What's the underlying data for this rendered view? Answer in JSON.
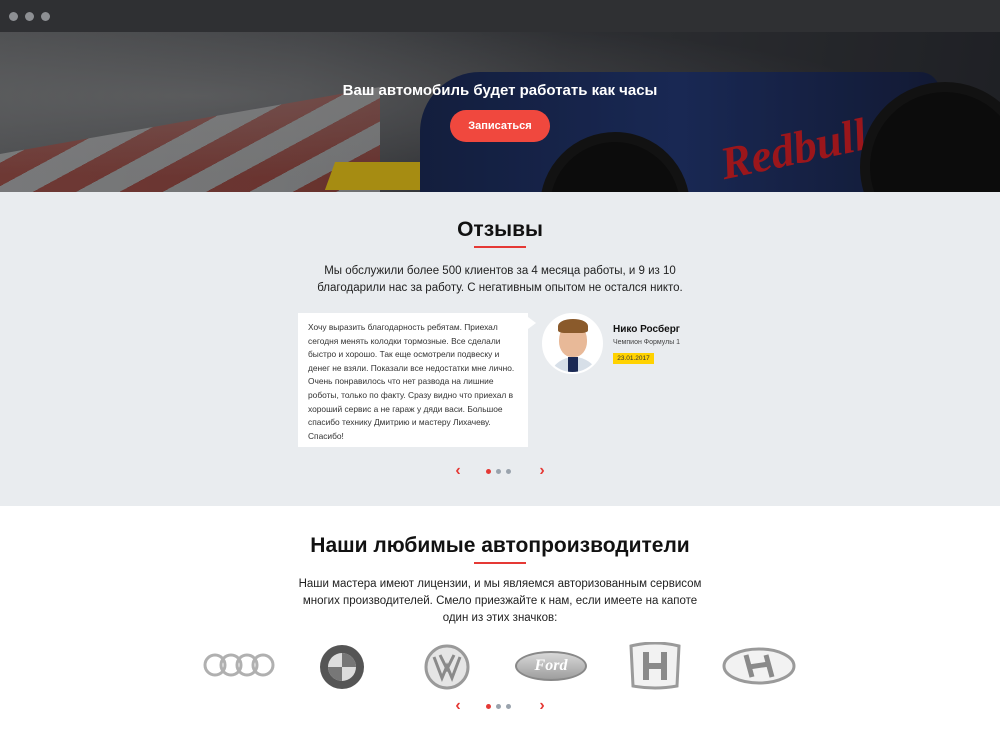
{
  "hero": {
    "tagline": "Ваш автомобиль будет работать как часы",
    "cta_label": "Записаться",
    "car_text": "Redbull"
  },
  "reviews": {
    "title": "Отзывы",
    "intro": "Мы обслужили более 500 клиентов за 4 месяца работы, и 9 из 10 благодарили нас за работу. С негативным опытом не остался никто.",
    "review_text": "Хочу выразить благодарность ребятам. Приехал сегодня менять колодки тормозные. Все сделали быстро и хорошо. Так еще осмотрели подвеску и денег не взяли. Показали все недостатки мне лично. Очень понравилось что нет развода на лишние роботы, только по факту. Сразу видно что приехал в хороший сервис а не гараж у дяди васи. Большое спасибо технику Дмитрию и мастеру Лихачеву. Спасибо!",
    "author_name": "Нико Росберг",
    "author_role": "Чемпион Формулы 1",
    "author_date": "23.01.2017",
    "prev_arrow": "‹",
    "next_arrow": "›"
  },
  "brands": {
    "title": "Наши любимые автопроизводители",
    "intro": "Наши мастера имеют лицензии, и мы являемся авторизованным сервисом многих производителей. Смело приезжайте к нам, если имеете на капоте один из этих значков:",
    "ford_text": "Ford",
    "prev_arrow": "‹",
    "next_arrow": "›"
  },
  "colors": {
    "accent": "#f0483e",
    "underline": "#e53935",
    "date_badge": "#ffd200",
    "section_bg": "#e9ecef"
  },
  "icons": [
    "audi-logo-icon",
    "bmw-logo-icon",
    "vw-logo-icon",
    "ford-logo-icon",
    "honda-logo-icon",
    "hyundai-logo-icon"
  ]
}
